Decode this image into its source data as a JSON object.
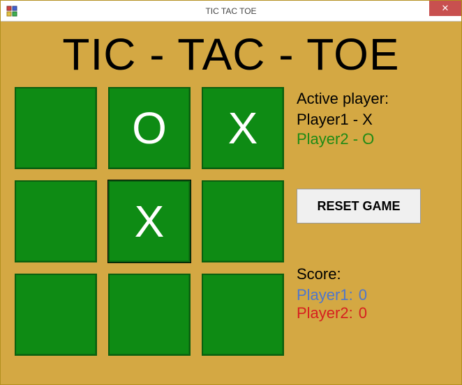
{
  "window": {
    "title": "TIC TAC TOE",
    "close": "✕"
  },
  "game": {
    "title": "TIC - TAC - TOE",
    "board": {
      "cells": [
        "",
        "O",
        "X",
        "",
        "X",
        "",
        "",
        "",
        ""
      ],
      "selected_index": 4
    },
    "legend": {
      "heading": "Active player:",
      "p1": "Player1  -  X",
      "p2": "Player2  -  O"
    },
    "reset_label": "RESET GAME",
    "score": {
      "heading": "Score:",
      "p1_label": "Player1:",
      "p1_value": "0",
      "p2_label": "Player2:",
      "p2_value": "0"
    }
  }
}
